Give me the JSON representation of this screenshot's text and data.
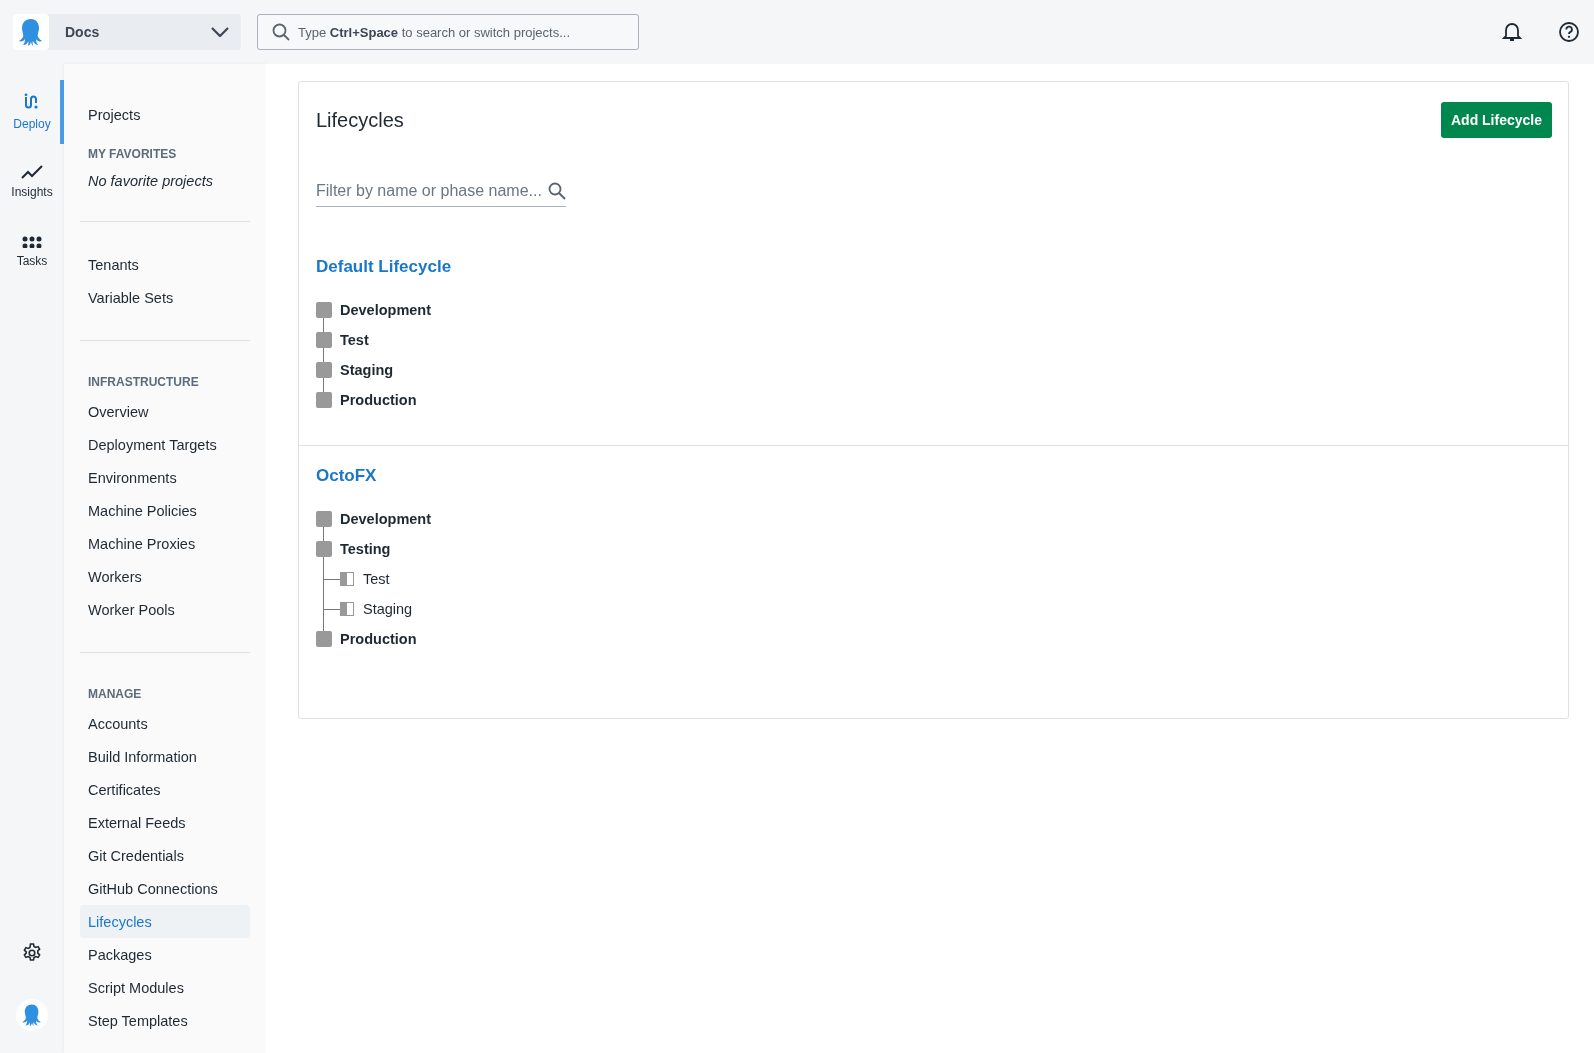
{
  "project_switcher": {
    "label": "Docs"
  },
  "search": {
    "placeholder": "Type **Ctrl+Space** to search or switch projects..."
  },
  "rail": [
    {
      "label": "Deploy",
      "selected": true
    },
    {
      "label": "Insights",
      "selected": false
    },
    {
      "label": "Tasks",
      "selected": false
    }
  ],
  "sidebar": [
    {
      "items": [
        {
          "label": "Projects",
          "selected": false
        }
      ],
      "heading": "MY FAVORITES",
      "note": "No favorite projects"
    },
    {
      "items": [
        {
          "label": "Tenants",
          "selected": false
        },
        {
          "label": "Variable Sets",
          "selected": false
        }
      ]
    },
    {
      "heading": "INFRASTRUCTURE",
      "items": [
        {
          "label": "Overview",
          "selected": false
        },
        {
          "label": "Deployment Targets",
          "selected": false
        },
        {
          "label": "Environments",
          "selected": false
        },
        {
          "label": "Machine Policies",
          "selected": false
        },
        {
          "label": "Machine Proxies",
          "selected": false
        },
        {
          "label": "Workers",
          "selected": false
        },
        {
          "label": "Worker Pools",
          "selected": false
        }
      ]
    },
    {
      "heading": "MANAGE",
      "items": [
        {
          "label": "Accounts",
          "selected": false
        },
        {
          "label": "Build Information",
          "selected": false
        },
        {
          "label": "Certificates",
          "selected": false
        },
        {
          "label": "External Feeds",
          "selected": false
        },
        {
          "label": "Git Credentials",
          "selected": false
        },
        {
          "label": "GitHub Connections",
          "selected": false
        },
        {
          "label": "Lifecycles",
          "selected": true
        },
        {
          "label": "Packages",
          "selected": false
        },
        {
          "label": "Script Modules",
          "selected": false
        },
        {
          "label": "Step Templates",
          "selected": false
        }
      ]
    }
  ],
  "page": {
    "title": "Lifecycles",
    "add_button": "Add Lifecycle",
    "filter": {
      "placeholder": "Filter by name or phase name..."
    }
  },
  "lifecycles": [
    {
      "name": "Default Lifecycle",
      "phases": [
        {
          "name": "Development"
        },
        {
          "name": "Test"
        },
        {
          "name": "Staging"
        },
        {
          "name": "Production"
        }
      ]
    },
    {
      "name": "OctoFX",
      "phases": [
        {
          "name": "Development"
        },
        {
          "name": "Testing",
          "children": [
            {
              "name": "Test"
            },
            {
              "name": "Staging"
            }
          ]
        },
        {
          "name": "Production"
        }
      ]
    }
  ]
}
